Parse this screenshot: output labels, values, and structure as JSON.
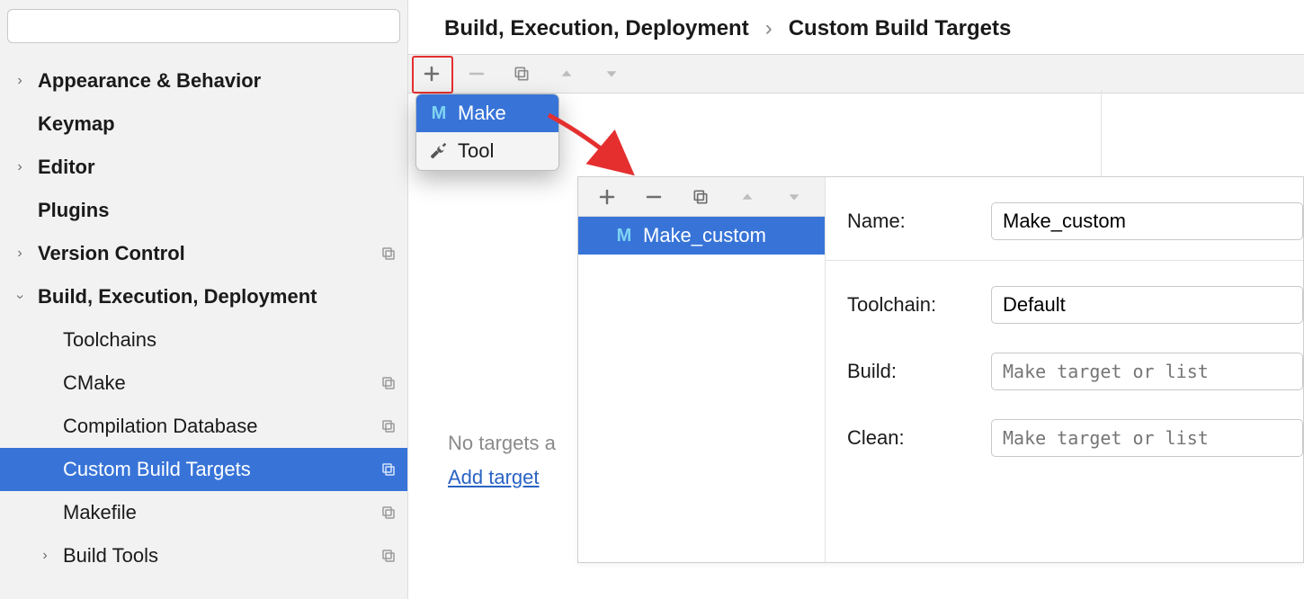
{
  "search": {
    "placeholder": ""
  },
  "sidebar": {
    "items": [
      {
        "label": "Appearance & Behavior",
        "arrow": "right",
        "bold": true
      },
      {
        "label": "Keymap",
        "arrow": "",
        "bold": true
      },
      {
        "label": "Editor",
        "arrow": "right",
        "bold": true
      },
      {
        "label": "Plugins",
        "arrow": "",
        "bold": true
      },
      {
        "label": "Version Control",
        "arrow": "right",
        "bold": true,
        "copy": true
      },
      {
        "label": "Build, Execution, Deployment",
        "arrow": "down",
        "bold": true
      },
      {
        "label": "Toolchains",
        "sub": true
      },
      {
        "label": "CMake",
        "sub": true,
        "copy": true
      },
      {
        "label": "Compilation Database",
        "sub": true,
        "copy": true
      },
      {
        "label": "Custom Build Targets",
        "sub": true,
        "copy": true,
        "selected": true
      },
      {
        "label": "Makefile",
        "sub": true,
        "copy": true
      },
      {
        "label": "Build Tools",
        "sub2": true,
        "arrow": "right",
        "copy": true
      }
    ]
  },
  "breadcrumb": {
    "a": "Build, Execution, Deployment",
    "b": "Custom Build Targets"
  },
  "popup": {
    "make": "Make",
    "tool": "Tool"
  },
  "empty": {
    "line1": "No targets a",
    "link": "Add target"
  },
  "target_list": {
    "item0": "Make_custom"
  },
  "form": {
    "name_label": "Name:",
    "name_value": "Make_custom",
    "toolchain_label": "Toolchain:",
    "toolchain_value": "Default",
    "build_label": "Build:",
    "build_placeholder": "Make target or list",
    "clean_label": "Clean:",
    "clean_placeholder": "Make target or list"
  }
}
